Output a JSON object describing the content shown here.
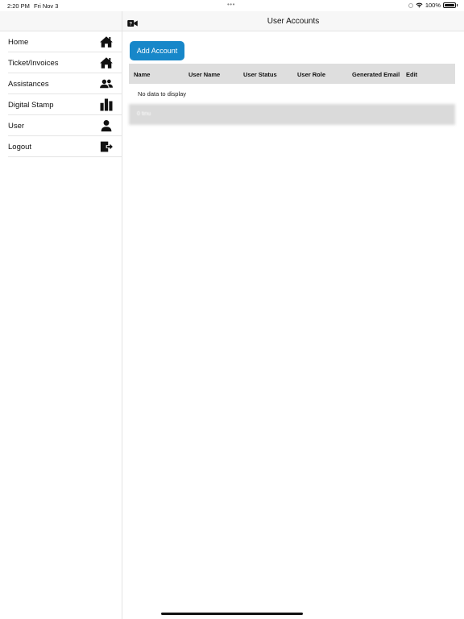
{
  "status_bar": {
    "time": "2:20 PM",
    "date": "Fri Nov 3",
    "multitask_dots": "•••",
    "battery": "100%",
    "icons": [
      "focus-ring-icon",
      "wifi-icon",
      "battery-icon"
    ]
  },
  "sidebar": {
    "items": [
      {
        "label": "Home",
        "icon": "home-icon"
      },
      {
        "label": "Ticket/Invoices",
        "icon": "home-icon"
      },
      {
        "label": "Assistances",
        "icon": "people-icon"
      },
      {
        "label": "Digital Stamp",
        "icon": "building-icon"
      },
      {
        "label": "User",
        "icon": "person-icon"
      },
      {
        "label": "Logout",
        "icon": "logout-icon"
      }
    ]
  },
  "navbar": {
    "title": "User Accounts",
    "help_icon": "help-video-icon"
  },
  "toolbar": {
    "add_account_label": "Add Account"
  },
  "table": {
    "columns": [
      "Name",
      "User Name",
      "User Status",
      "User Role",
      "Generated Email",
      "Edit"
    ],
    "empty_text": "No data to display",
    "group_text": "0 tinu"
  },
  "colors": {
    "accent": "#1787c9",
    "header_bg": "#dedede",
    "nav_bg": "#f7f7f7"
  }
}
